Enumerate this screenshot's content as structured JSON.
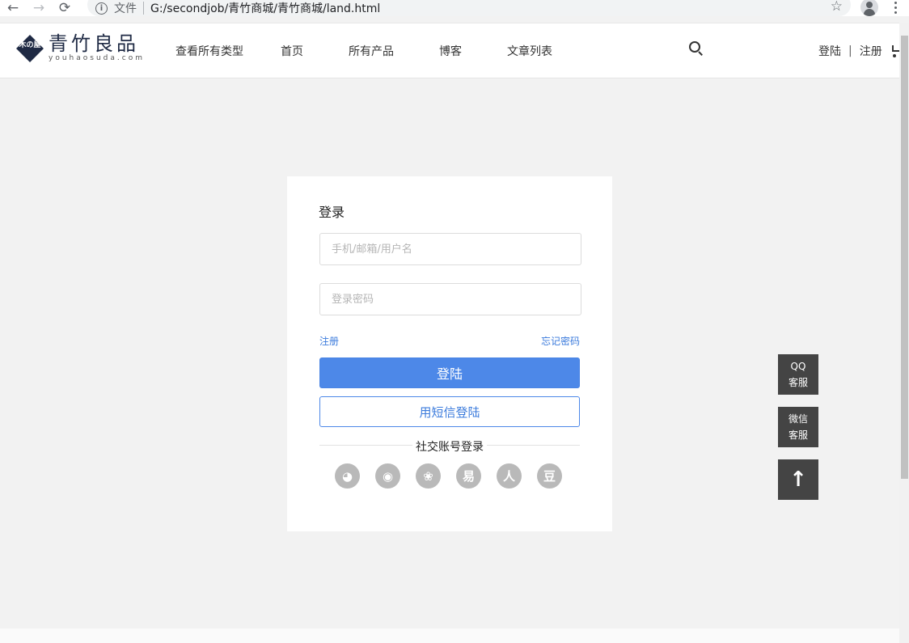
{
  "browser": {
    "scheme_label": "文件",
    "url": "G:/secondjob/青竹商城/青竹商城/land.html",
    "back_glyph": "←",
    "forward_glyph": "→",
    "reload_glyph": "⟳",
    "info_glyph": "i",
    "star_glyph": "☆"
  },
  "header": {
    "logo_cn": "青竹良品",
    "logo_en": "youhaosuda.com",
    "logo_glyph": "木の屋",
    "nav": [
      "查看所有类型",
      "首页",
      "所有产品",
      "博客",
      "文章列表"
    ],
    "login_link": "登陆",
    "auth_divider": "|",
    "register_link": "注册"
  },
  "login_card": {
    "title": "登录",
    "username_placeholder": "手机/邮箱/用户名",
    "password_placeholder": "登录密码",
    "register_link": "注册",
    "forgot_link": "忘记密码",
    "login_button": "登陆",
    "sms_button": "用短信登陆",
    "social_title": "社交账号登录",
    "social_icons": [
      {
        "name": "qq-icon",
        "glyph": "◕"
      },
      {
        "name": "weibo-icon",
        "glyph": "◉"
      },
      {
        "name": "wechat-icon",
        "glyph": "❀"
      },
      {
        "name": "netease-icon",
        "glyph": "易"
      },
      {
        "name": "renren-icon",
        "glyph": "人"
      },
      {
        "name": "douban-icon",
        "glyph": "豆"
      }
    ]
  },
  "float": {
    "qq_line1": "QQ",
    "qq_line2": "客服",
    "wechat_line1": "微信",
    "wechat_line2": "客服",
    "top_glyph": "↑"
  },
  "colors": {
    "primary": "#4d88e8",
    "link": "#3b7bdc",
    "float_bg": "#444444",
    "page_bg": "#f2f2f2"
  }
}
